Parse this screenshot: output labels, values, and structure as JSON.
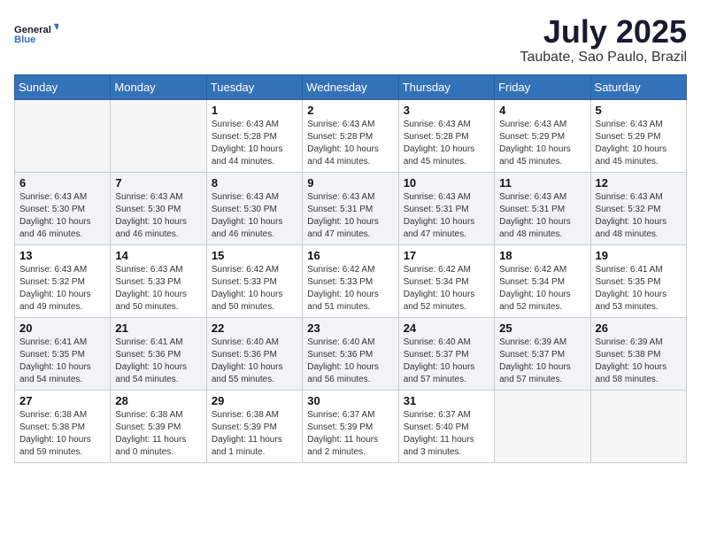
{
  "header": {
    "logo_line1": "General",
    "logo_line2": "Blue",
    "month": "July 2025",
    "location": "Taubate, Sao Paulo, Brazil"
  },
  "weekdays": [
    "Sunday",
    "Monday",
    "Tuesday",
    "Wednesday",
    "Thursday",
    "Friday",
    "Saturday"
  ],
  "weeks": [
    [
      {
        "day": "",
        "detail": ""
      },
      {
        "day": "",
        "detail": ""
      },
      {
        "day": "1",
        "detail": "Sunrise: 6:43 AM\nSunset: 5:28 PM\nDaylight: 10 hours\nand 44 minutes."
      },
      {
        "day": "2",
        "detail": "Sunrise: 6:43 AM\nSunset: 5:28 PM\nDaylight: 10 hours\nand 44 minutes."
      },
      {
        "day": "3",
        "detail": "Sunrise: 6:43 AM\nSunset: 5:28 PM\nDaylight: 10 hours\nand 45 minutes."
      },
      {
        "day": "4",
        "detail": "Sunrise: 6:43 AM\nSunset: 5:29 PM\nDaylight: 10 hours\nand 45 minutes."
      },
      {
        "day": "5",
        "detail": "Sunrise: 6:43 AM\nSunset: 5:29 PM\nDaylight: 10 hours\nand 45 minutes."
      }
    ],
    [
      {
        "day": "6",
        "detail": "Sunrise: 6:43 AM\nSunset: 5:30 PM\nDaylight: 10 hours\nand 46 minutes."
      },
      {
        "day": "7",
        "detail": "Sunrise: 6:43 AM\nSunset: 5:30 PM\nDaylight: 10 hours\nand 46 minutes."
      },
      {
        "day": "8",
        "detail": "Sunrise: 6:43 AM\nSunset: 5:30 PM\nDaylight: 10 hours\nand 46 minutes."
      },
      {
        "day": "9",
        "detail": "Sunrise: 6:43 AM\nSunset: 5:31 PM\nDaylight: 10 hours\nand 47 minutes."
      },
      {
        "day": "10",
        "detail": "Sunrise: 6:43 AM\nSunset: 5:31 PM\nDaylight: 10 hours\nand 47 minutes."
      },
      {
        "day": "11",
        "detail": "Sunrise: 6:43 AM\nSunset: 5:31 PM\nDaylight: 10 hours\nand 48 minutes."
      },
      {
        "day": "12",
        "detail": "Sunrise: 6:43 AM\nSunset: 5:32 PM\nDaylight: 10 hours\nand 48 minutes."
      }
    ],
    [
      {
        "day": "13",
        "detail": "Sunrise: 6:43 AM\nSunset: 5:32 PM\nDaylight: 10 hours\nand 49 minutes."
      },
      {
        "day": "14",
        "detail": "Sunrise: 6:43 AM\nSunset: 5:33 PM\nDaylight: 10 hours\nand 50 minutes."
      },
      {
        "day": "15",
        "detail": "Sunrise: 6:42 AM\nSunset: 5:33 PM\nDaylight: 10 hours\nand 50 minutes."
      },
      {
        "day": "16",
        "detail": "Sunrise: 6:42 AM\nSunset: 5:33 PM\nDaylight: 10 hours\nand 51 minutes."
      },
      {
        "day": "17",
        "detail": "Sunrise: 6:42 AM\nSunset: 5:34 PM\nDaylight: 10 hours\nand 52 minutes."
      },
      {
        "day": "18",
        "detail": "Sunrise: 6:42 AM\nSunset: 5:34 PM\nDaylight: 10 hours\nand 52 minutes."
      },
      {
        "day": "19",
        "detail": "Sunrise: 6:41 AM\nSunset: 5:35 PM\nDaylight: 10 hours\nand 53 minutes."
      }
    ],
    [
      {
        "day": "20",
        "detail": "Sunrise: 6:41 AM\nSunset: 5:35 PM\nDaylight: 10 hours\nand 54 minutes."
      },
      {
        "day": "21",
        "detail": "Sunrise: 6:41 AM\nSunset: 5:36 PM\nDaylight: 10 hours\nand 54 minutes."
      },
      {
        "day": "22",
        "detail": "Sunrise: 6:40 AM\nSunset: 5:36 PM\nDaylight: 10 hours\nand 55 minutes."
      },
      {
        "day": "23",
        "detail": "Sunrise: 6:40 AM\nSunset: 5:36 PM\nDaylight: 10 hours\nand 56 minutes."
      },
      {
        "day": "24",
        "detail": "Sunrise: 6:40 AM\nSunset: 5:37 PM\nDaylight: 10 hours\nand 57 minutes."
      },
      {
        "day": "25",
        "detail": "Sunrise: 6:39 AM\nSunset: 5:37 PM\nDaylight: 10 hours\nand 57 minutes."
      },
      {
        "day": "26",
        "detail": "Sunrise: 6:39 AM\nSunset: 5:38 PM\nDaylight: 10 hours\nand 58 minutes."
      }
    ],
    [
      {
        "day": "27",
        "detail": "Sunrise: 6:38 AM\nSunset: 5:38 PM\nDaylight: 10 hours\nand 59 minutes."
      },
      {
        "day": "28",
        "detail": "Sunrise: 6:38 AM\nSunset: 5:39 PM\nDaylight: 11 hours\nand 0 minutes."
      },
      {
        "day": "29",
        "detail": "Sunrise: 6:38 AM\nSunset: 5:39 PM\nDaylight: 11 hours\nand 1 minute."
      },
      {
        "day": "30",
        "detail": "Sunrise: 6:37 AM\nSunset: 5:39 PM\nDaylight: 11 hours\nand 2 minutes."
      },
      {
        "day": "31",
        "detail": "Sunrise: 6:37 AM\nSunset: 5:40 PM\nDaylight: 11 hours\nand 3 minutes."
      },
      {
        "day": "",
        "detail": ""
      },
      {
        "day": "",
        "detail": ""
      }
    ]
  ]
}
